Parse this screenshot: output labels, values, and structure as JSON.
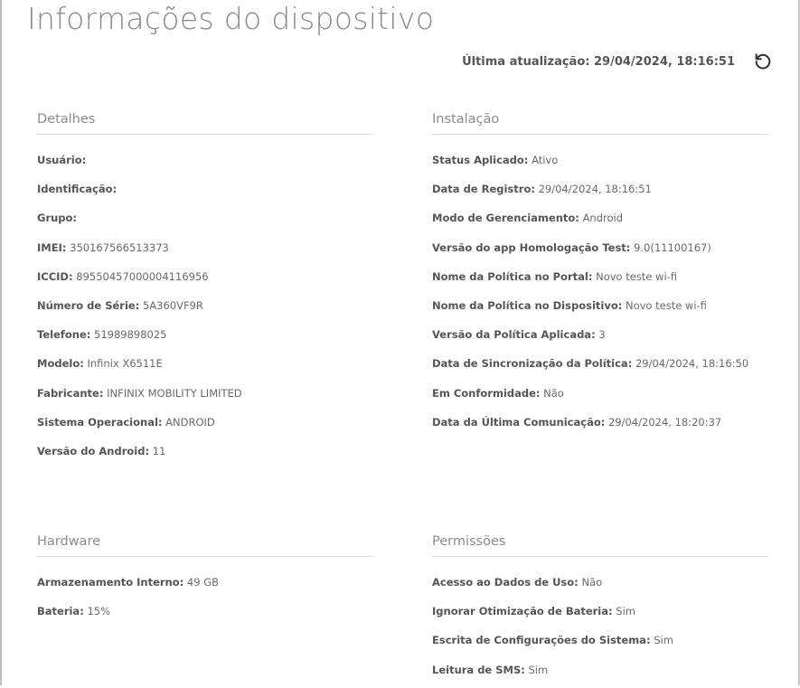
{
  "page": {
    "title": "Informações do dispositivo"
  },
  "update": {
    "label": "Última atualização:",
    "value": "29/04/2024, 18:16:51",
    "icon": "refresh-icon"
  },
  "details": {
    "title": "Detalhes",
    "items": [
      {
        "label": "Usuário:",
        "value": ""
      },
      {
        "label": "Identificação:",
        "value": ""
      },
      {
        "label": "Grupo:",
        "value": ""
      },
      {
        "label": "IMEI:",
        "value": "350167566513373"
      },
      {
        "label": "ICCID:",
        "value": "89550457000004116956"
      },
      {
        "label": "Número de Série:",
        "value": "5A360VF9R"
      },
      {
        "label": "Telefone:",
        "value": "51989898025"
      },
      {
        "label": "Modelo:",
        "value": "Infinix X6511E"
      },
      {
        "label": "Fabricante:",
        "value": "INFINIX MOBILITY LIMITED"
      },
      {
        "label": "Sistema Operacional:",
        "value": "ANDROID"
      },
      {
        "label": "Versão do Android:",
        "value": "11"
      }
    ]
  },
  "installation": {
    "title": "Instalação",
    "items": [
      {
        "label": "Status Aplicado:",
        "value": "Ativo"
      },
      {
        "label": "Data de Registro:",
        "value": "29/04/2024, 18:16:51"
      },
      {
        "label": "Modo de Gerenciamento:",
        "value": "Android"
      },
      {
        "label": "Versão do app Homologação Test:",
        "value": "9.0(11100167)"
      },
      {
        "label": "Nome da Política no Portal:",
        "value": "Novo teste wi-fi"
      },
      {
        "label": "Nome da Política no Dispositivo:",
        "value": "Novo teste wi-fi"
      },
      {
        "label": "Versão da Política Aplicada:",
        "value": "3"
      },
      {
        "label": "Data de Sincronização da Política:",
        "value": "29/04/2024, 18:16:50"
      },
      {
        "label": "Em Conformidade:",
        "value": "Não"
      },
      {
        "label": "Data da Última Comunicação:",
        "value": "29/04/2024, 18:20:37"
      }
    ]
  },
  "hardware": {
    "title": "Hardware",
    "items": [
      {
        "label": "Armazenamento Interno:",
        "value": "49 GB"
      },
      {
        "label": "Bateria:",
        "value": "15%"
      }
    ]
  },
  "permissions": {
    "title": "Permissões",
    "items": [
      {
        "label": "Acesso ao Dados de Uso:",
        "value": "Não"
      },
      {
        "label": "Ignorar Otimização de Bateria:",
        "value": "Sim"
      },
      {
        "label": "Escrita de Configurações do Sistema:",
        "value": "Sim"
      },
      {
        "label": "Leitura de SMS:",
        "value": "Sim"
      }
    ]
  }
}
